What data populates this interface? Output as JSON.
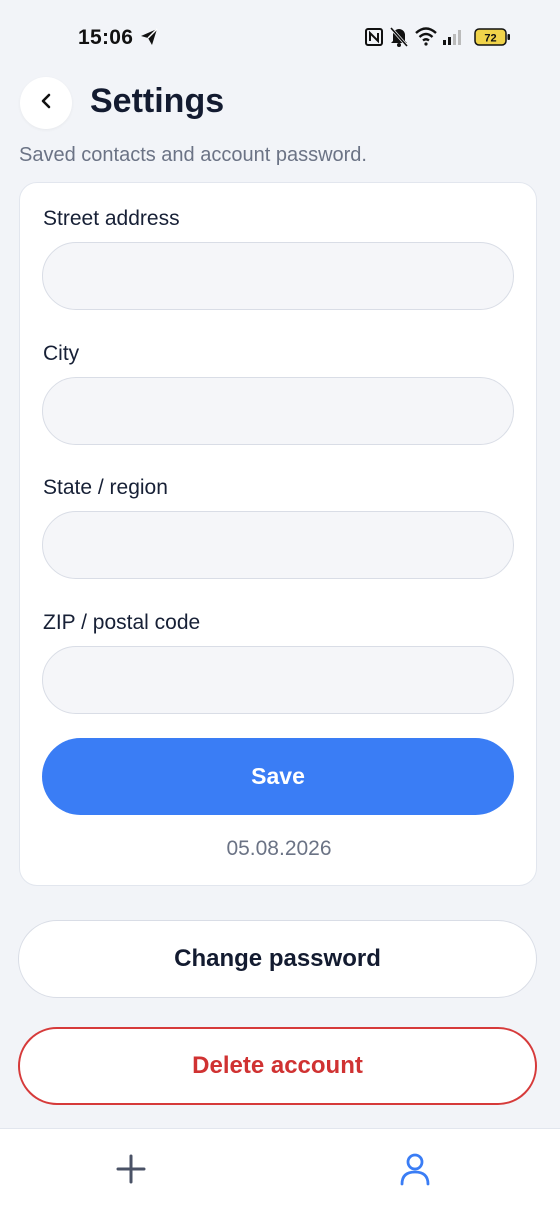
{
  "status_bar": {
    "time": "15:06",
    "battery_level": "72",
    "icons": [
      "telegram-icon",
      "nfc-icon",
      "bell-muted-icon",
      "wifi-icon",
      "signal-icon",
      "battery-icon"
    ]
  },
  "header": {
    "title": "Settings",
    "subtitle": "Saved contacts and account password.",
    "back_icon": "chevron-left-icon"
  },
  "form": {
    "fields": [
      {
        "label": "Street address",
        "value": "",
        "placeholder": ""
      },
      {
        "label": "City",
        "value": "",
        "placeholder": ""
      },
      {
        "label": "State / region",
        "value": "",
        "placeholder": ""
      },
      {
        "label": "ZIP / postal code",
        "value": "",
        "placeholder": ""
      }
    ],
    "save_label": "Save",
    "date": "05.08.2026"
  },
  "actions": {
    "change_password_label": "Change password",
    "delete_account_label": "Delete account"
  },
  "bottom_nav": {
    "items": [
      {
        "icon": "plus-icon",
        "active": false
      },
      {
        "icon": "user-icon",
        "active": true
      }
    ]
  },
  "colors": {
    "accent": "#3a7df5",
    "danger": "#d63a3a",
    "background": "#f2f4f8"
  }
}
